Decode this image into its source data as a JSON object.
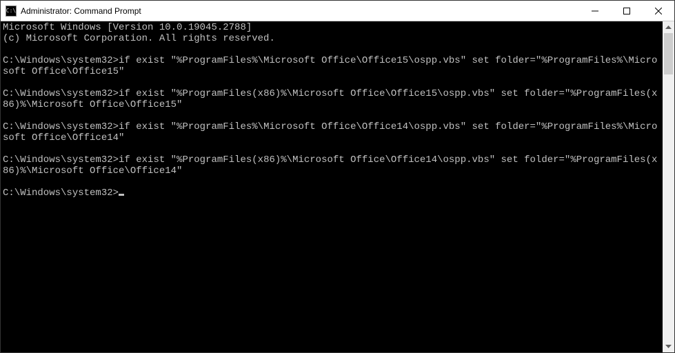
{
  "window": {
    "title": "Administrator: Command Prompt",
    "icon_label": "C:\\"
  },
  "terminal": {
    "banner1": "Microsoft Windows [Version 10.0.19045.2788]",
    "banner2": "(c) Microsoft Corporation. All rights reserved.",
    "prompt": "C:\\Windows\\system32>",
    "cmd1": "if exist \"%ProgramFiles%\\Microsoft Office\\Office15\\ospp.vbs\" set folder=\"%ProgramFiles%\\Microsoft Office\\Office15\"",
    "cmd2": "if exist \"%ProgramFiles(x86)%\\Microsoft Office\\Office15\\ospp.vbs\" set folder=\"%ProgramFiles(x86)%\\Microsoft Office\\Office15\"",
    "cmd3": "if exist \"%ProgramFiles%\\Microsoft Office\\Office14\\ospp.vbs\" set folder=\"%ProgramFiles%\\Microsoft Office\\Office14\"",
    "cmd4": "if exist \"%ProgramFiles(x86)%\\Microsoft Office\\Office14\\ospp.vbs\" set folder=\"%ProgramFiles(x86)%\\Microsoft Office\\Office14\""
  }
}
